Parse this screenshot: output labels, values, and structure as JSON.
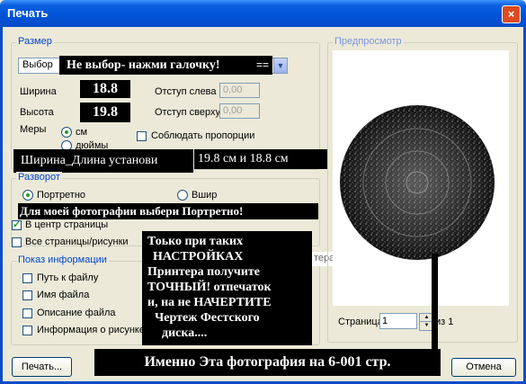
{
  "window": {
    "title": "Печать",
    "close_glyph": "×"
  },
  "size_group": {
    "legend": "Размер",
    "preset_value": "Выбор",
    "preset_annotation": "Не выбор- нажми галочку!",
    "preset_arrow_marks": "==",
    "width_label": "Ширина",
    "width_value": "18.8",
    "height_label": "Высота",
    "height_value": "19.8",
    "margin_left_label": "Отступ слева",
    "margin_left_value": "0,00",
    "margin_top_label": "Отступ сверху",
    "margin_top_value": "0,00",
    "units_label": "Меры",
    "unit_cm": "см",
    "unit_in": "дюймы",
    "keep_proportions": "Соблюдать пропорции",
    "size_annotation_left": "Ширина_Длина установи",
    "size_annotation_right": "19.8 см и 18.8 см"
  },
  "orientation_group": {
    "legend": "Разворот",
    "portrait": "Портретно",
    "landscape": "Вшир",
    "orientation_annotation": "Для моей фотографии выбери Портретно!",
    "center_page": "В центр страницы",
    "all_pages": "Все страницы/рисунки"
  },
  "info_group": {
    "legend": "Показ информации",
    "file_path": "Путь к файлу",
    "file_name": "Имя файла",
    "file_description": "Описание файла",
    "image_info": "Информация о рисунке"
  },
  "big_annotation": [
    "Тоько при таких",
    "НАСТРОЙКАХ",
    "Принтера получите",
    "ТОЧНЫЙ! отпечаток",
    "и, на не НАЧЕРТИТЕ",
    "Чертеж Фестского",
    "диска...."
  ],
  "partial_text": "тера",
  "preview_group": {
    "legend": "Предпросмотр",
    "page_label": "Страница",
    "page_value": "1",
    "of_label": "из 1"
  },
  "bottom_annotation": "Именно Эта фотография на 6-001 стр.",
  "buttons": {
    "print": "Печать...",
    "cancel": "Отмена"
  },
  "colors": {
    "titlebar": "#0052d6",
    "legend_text": "#0046d5",
    "annotation_bg": "#000000",
    "dialog_bg": "#ece9d8"
  }
}
